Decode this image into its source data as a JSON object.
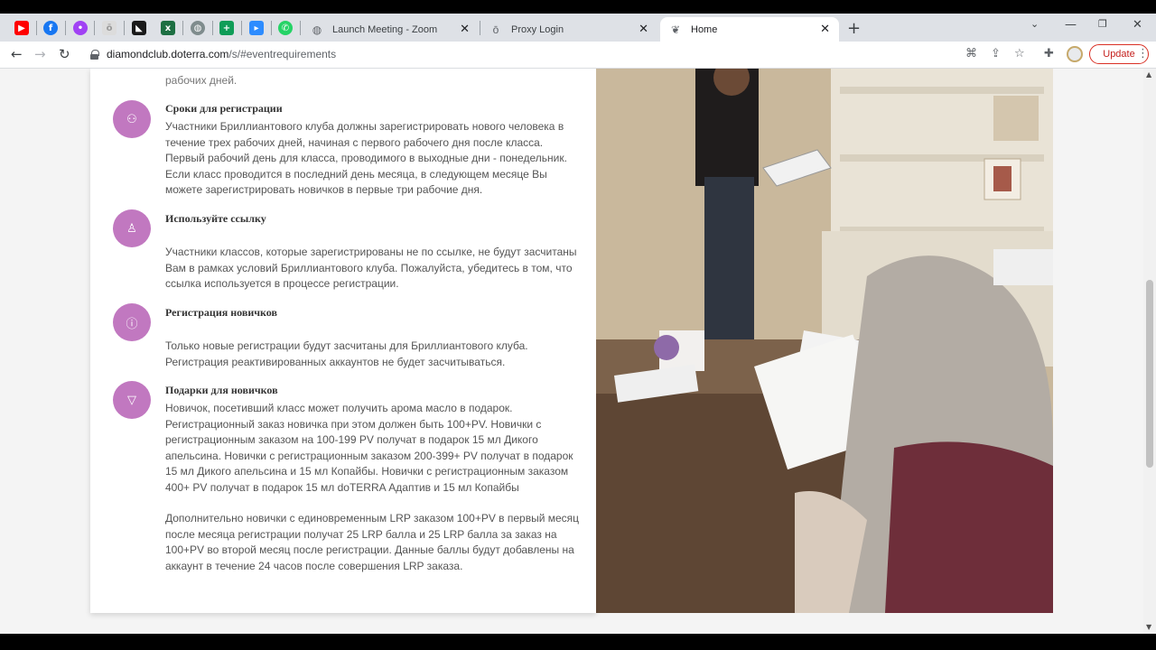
{
  "browser": {
    "pinned_tabs": [
      {
        "icon": "youtube-icon",
        "color": "#ff0000"
      },
      {
        "icon": "facebook-icon",
        "color": "#1877f2"
      },
      {
        "icon": "app-icon",
        "color": "#a142f4"
      },
      {
        "icon": "doterra-icon",
        "color": "#bdbdbd"
      },
      {
        "icon": "bookmark-icon",
        "color": "#1a1a1a"
      },
      {
        "icon": "excel-icon",
        "color": "#1d6f42"
      },
      {
        "icon": "globe-icon",
        "color": "#7f8c8d"
      },
      {
        "icon": "sheets-icon",
        "color": "#0f9d58"
      },
      {
        "icon": "zoom-icon",
        "color": "#2d8cff"
      },
      {
        "icon": "whatsapp-icon",
        "color": "#25d366"
      }
    ],
    "tabs": [
      {
        "title": "Launch Meeting - Zoom",
        "active": false,
        "close": "✕"
      },
      {
        "title": "Proxy Login",
        "active": false,
        "close": "✕"
      },
      {
        "title": "Home",
        "active": true,
        "close": "✕"
      }
    ],
    "url_host": "diamondclub.doterra.com",
    "url_path": "/s/#eventrequirements",
    "update_label": "Update"
  },
  "page": {
    "lead_text": "рабочих дней.",
    "items": [
      {
        "icon": "users-icon",
        "title": "Сроки для регистрации",
        "text": "Участники Бриллиантового клуба должны зарегистрировать нового человека в течение трех рабочих дней, начиная с первого рабочего дня после класса. Первый рабочий день для класса, проводимого в выходные дни - понедельник. Если класс проводится в последний день месяца, в следующем месяце Вы можете зарегистрировать новичков в первые три рабочие дня."
      },
      {
        "icon": "user-icon",
        "title": "Используйте ссылку",
        "text": "Участники классов, которые зарегистрированы не по ссылке, не будут засчитаны Вам в рамках условий Бриллиантового клуба. Пожалуйста, убедитесь в том, что ссылка используется в процессе регистрации."
      },
      {
        "icon": "info-icon",
        "title": "Регистрация новичков",
        "text": "Только новые регистрации будут засчитаны для Бриллиантового клуба. Регистрация реактивированных аккаунтов не будет засчитываться."
      },
      {
        "icon": "filter-icon",
        "title": "Подарки для новичков",
        "text": "Новичок, посетивший класс может получить арома масло в подарок. Регистрационный заказ новичка при этом должен быть 100+PV.  Новички с регистрационным заказом на 100-199 PV получат в подарок 15 мл Дикого апельсина. Новички с регистрационным заказом 200-399+ PV получат в подарок 15 мл Дикого апельсина и 15 мл Копайбы. Новички с регистрационным заказом 400+ PV получат в подарок 15 мл doTERRA Адаптив и 15 мл Копайбы",
        "text2": "Дополнительно новички с единовременным LRP заказом 100+PV в первый месяц после месяца регистрации получат 25 LRP балла и 25 LRP балла за заказ на 100+PV во второй месяц после регистрации. Данные баллы будут добавлены на аккаунт в течение 24 часов после совершения LRP заказа."
      }
    ],
    "accent_color": "#c178c0"
  }
}
